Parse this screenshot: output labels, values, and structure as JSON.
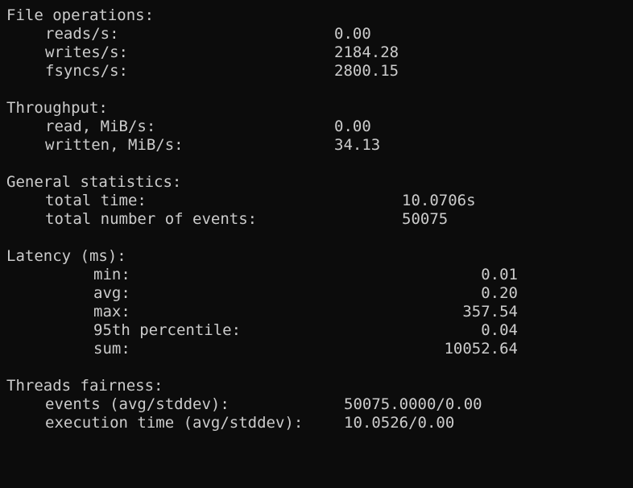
{
  "file_operations": {
    "heading": "File operations:",
    "reads_label": "reads/s:",
    "reads_value": "0.00",
    "writes_label": "writes/s:",
    "writes_value": "2184.28",
    "fsyncs_label": "fsyncs/s:",
    "fsyncs_value": "2800.15"
  },
  "throughput": {
    "heading": "Throughput:",
    "read_label": "read, MiB/s:",
    "read_value": "0.00",
    "written_label": "written, MiB/s:",
    "written_value": "34.13"
  },
  "general_statistics": {
    "heading": "General statistics:",
    "total_time_label": "total time:",
    "total_time_value": "10.0706s",
    "total_events_label": "total number of events:",
    "total_events_value": "50075"
  },
  "latency": {
    "heading": "Latency (ms):",
    "min_label": "min:",
    "min_value": "0.01",
    "avg_label": "avg:",
    "avg_value": "0.20",
    "max_label": "max:",
    "max_value": "357.54",
    "p95_label": "95th percentile:",
    "p95_value": "0.04",
    "sum_label": "sum:",
    "sum_value": "10052.64"
  },
  "threads_fairness": {
    "heading": "Threads fairness:",
    "events_label": "events (avg/stddev):",
    "events_value": "50075.0000/0.00",
    "exec_time_label": "execution time (avg/stddev):",
    "exec_time_value": "10.0526/0.00"
  }
}
